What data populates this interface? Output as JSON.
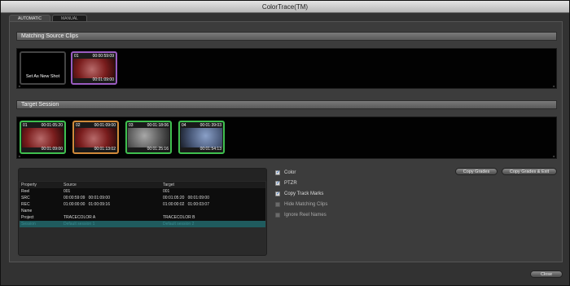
{
  "window": {
    "title": "ColorTrace(TM)"
  },
  "tabs": [
    {
      "label": "AUTOMATIC",
      "active": true
    },
    {
      "label": "MANUAL",
      "active": false
    }
  ],
  "matching": {
    "header": "Matching Source Clips",
    "new_shot_label": "Set As New Shot",
    "clip": {
      "num": "01",
      "tc_in": "00:00:59:09",
      "tc_out": "00:01:09:00"
    }
  },
  "target": {
    "header": "Target Session",
    "clips": [
      {
        "num": "01",
        "tc_in": "00:01:05:20",
        "tc_out": "00:01:09:00"
      },
      {
        "num": "02",
        "tc_in": "00:01:09:00",
        "tc_out": "00:01:13:02"
      },
      {
        "num": "03",
        "tc_in": "00:01:18:06",
        "tc_out": "00:01:25:16"
      },
      {
        "num": "04",
        "tc_in": "00:01:39:03",
        "tc_out": "00:01:54:13"
      }
    ]
  },
  "table": {
    "headers": [
      "Property",
      "Source",
      "Target"
    ],
    "rows": [
      [
        "Reel",
        "001",
        "001"
      ],
      [
        "SRC",
        "00:00:59:09   00:01:09:00",
        "00:01:05:20   00:01:09:00"
      ],
      [
        "REC",
        "01:00:00:00   01:00:09:16",
        "01:00:00:02   01:00:03:07"
      ],
      [
        "Name",
        "",
        ""
      ],
      [
        "Project",
        "TRACECOLOR A",
        "TRACECOLOR B"
      ],
      [
        "Session",
        "Default session 1",
        "Default session 2"
      ]
    ]
  },
  "options": [
    {
      "label": "Color",
      "checked": true
    },
    {
      "label": "PTZR",
      "checked": true
    },
    {
      "label": "Copy Track Marks",
      "checked": true
    },
    {
      "label": "Hide Matching Clips",
      "checked": false
    },
    {
      "label": "Ignore Reel Names",
      "checked": false
    }
  ],
  "buttons": {
    "copy_grades": "Copy Grades",
    "copy_grades_exit": "Copy Grades & Exit",
    "close": "Close"
  },
  "colors": {
    "matching_clip_border": "#9a5cc0",
    "target_border_green": "#3fbf4f",
    "target_border_orange": "#d08a3a",
    "selected_row": "#1f5b5e"
  }
}
